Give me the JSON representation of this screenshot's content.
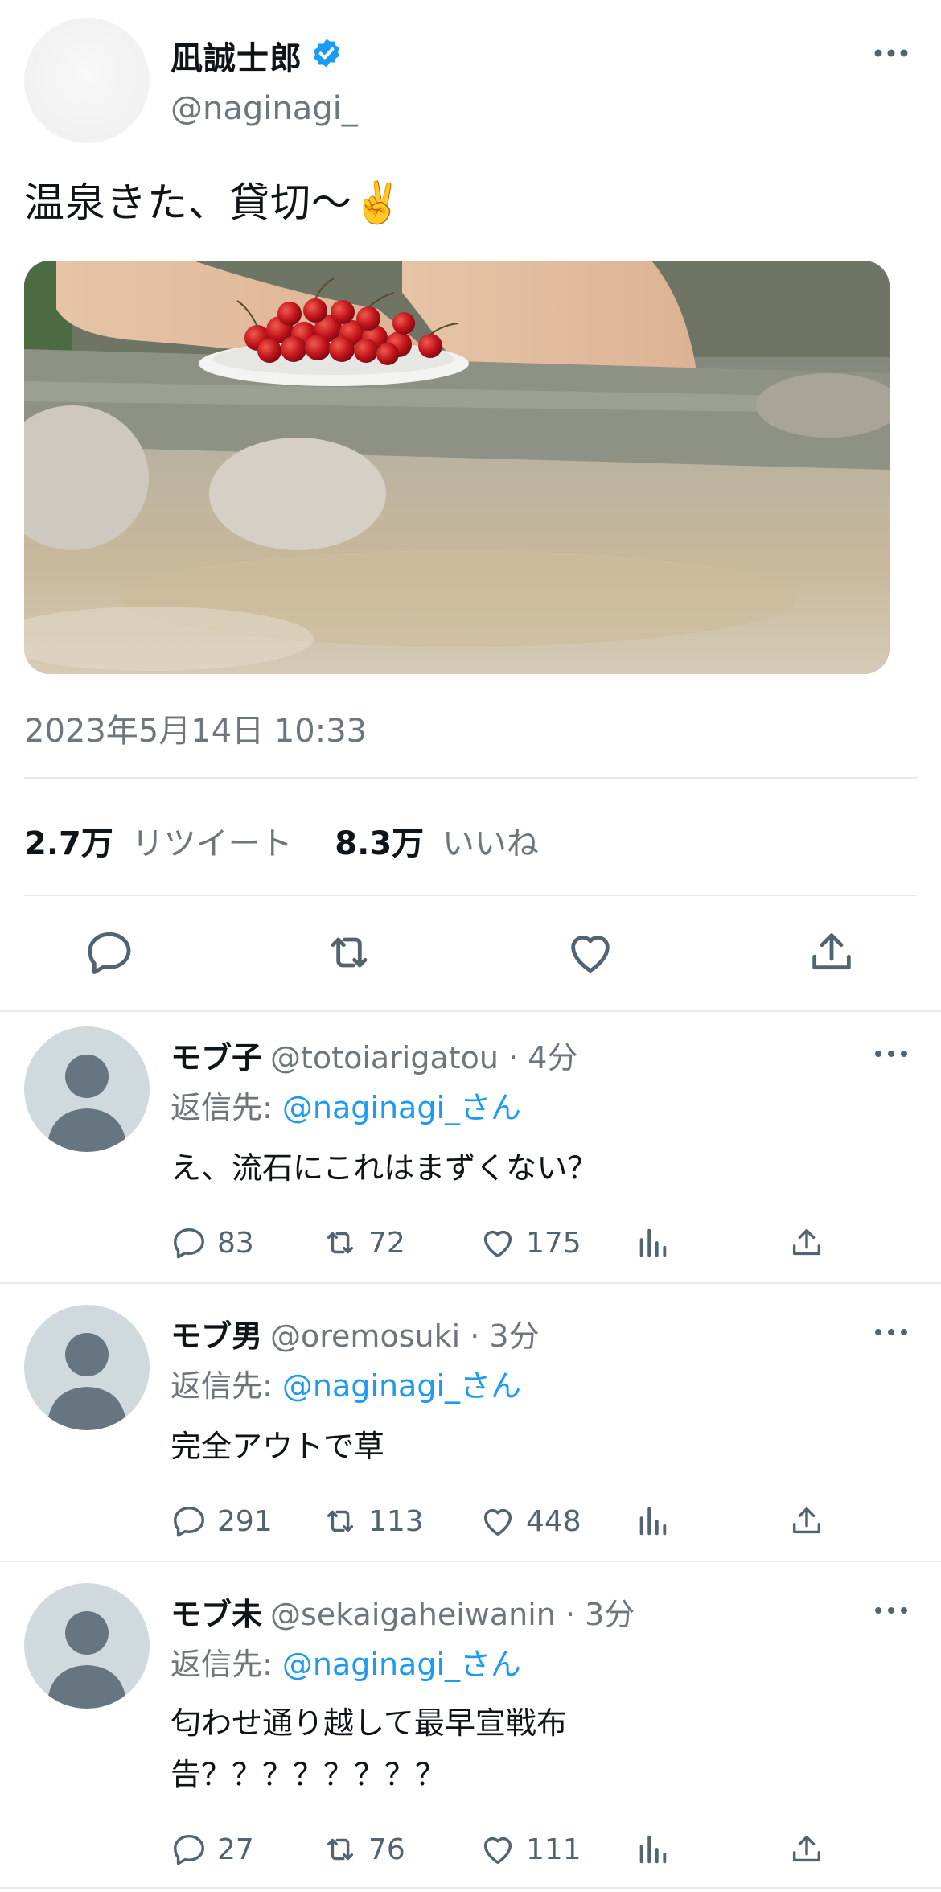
{
  "tweet": {
    "author_name": "凪誠士郎",
    "author_handle": "@naginagi_",
    "text": "温泉きた、貸切〜✌️",
    "timestamp": "2023年5月14日 10:33",
    "retweet_count": "2.7万",
    "retweet_label": "リツイート",
    "like_count": "8.3万",
    "like_label": "いいね",
    "icons": [
      "verified-badge-icon",
      "more-icon",
      "reply-icon",
      "retweet-icon",
      "like-icon",
      "share-icon"
    ]
  },
  "replies": [
    {
      "name": "モブ子",
      "handle": "@totoiarigatou",
      "time": "· 4分",
      "reply_to_label": "返信先:",
      "reply_to": "@naginagi_さん",
      "text": "え、流石にこれはまずくない？",
      "reply_count": "83",
      "retweet_count": "72",
      "like_count": "175"
    },
    {
      "name": "モブ男",
      "handle": "@oremosuki",
      "time": "· 3分",
      "reply_to_label": "返信先:",
      "reply_to": "@naginagi_さん",
      "text": "完全アウトで草",
      "reply_count": "291",
      "retweet_count": "113",
      "like_count": "448"
    },
    {
      "name": "モブ未",
      "handle": "@sekaigaheiwanin",
      "time": "· 3分",
      "reply_to_label": "返信先:",
      "reply_to": "@naginagi_さん",
      "text": "匂わせ通り越して最早宣戦布告？？？？？？？？",
      "reply_count": "27",
      "retweet_count": "76",
      "like_count": "111"
    }
  ],
  "colors": {
    "link": "#1d9bf0",
    "muted": "#6e767d",
    "text": "#0f1419",
    "divider": "#e7e9ea",
    "avatar_placeholder": "#cfd9de"
  }
}
